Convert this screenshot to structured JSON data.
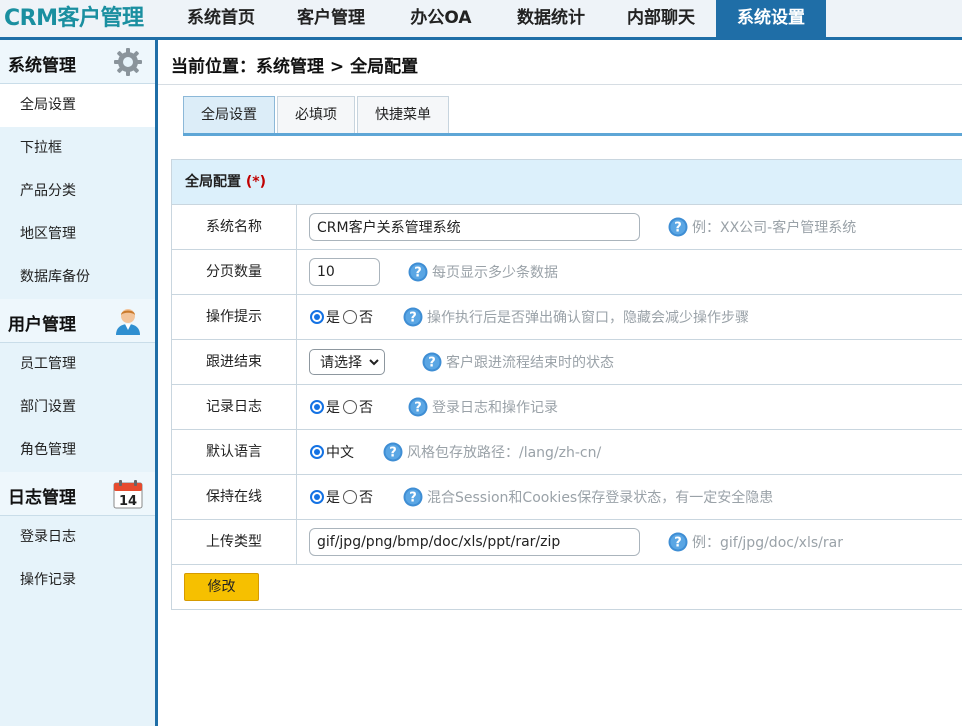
{
  "app": {
    "logo": "CRM客户管理"
  },
  "topnav": {
    "items": [
      {
        "label": "系统首页"
      },
      {
        "label": "客户管理"
      },
      {
        "label": "办公OA"
      },
      {
        "label": "数据统计"
      },
      {
        "label": "内部聊天"
      },
      {
        "label": "系统设置"
      }
    ],
    "active_index": 5
  },
  "sidebar": {
    "groups": [
      {
        "title": "系统管理",
        "icon": "gear-icon",
        "items": [
          {
            "label": "全局设置"
          },
          {
            "label": "下拉框"
          },
          {
            "label": "产品分类"
          },
          {
            "label": "地区管理"
          },
          {
            "label": "数据库备份"
          }
        ]
      },
      {
        "title": "用户管理",
        "icon": "user-icon",
        "items": [
          {
            "label": "员工管理"
          },
          {
            "label": "部门设置"
          },
          {
            "label": "角色管理"
          }
        ]
      },
      {
        "title": "日志管理",
        "icon": "calendar-icon",
        "icon_text": "14",
        "items": [
          {
            "label": "登录日志"
          },
          {
            "label": "操作记录"
          }
        ]
      }
    ],
    "active_item": "全局设置"
  },
  "breadcrumb": "当前位置：系统管理 > 全局配置",
  "tabs": [
    {
      "label": "全局设置"
    },
    {
      "label": "必填项"
    },
    {
      "label": "快捷菜单"
    }
  ],
  "panel": {
    "title": "全局配置",
    "required_mark": "(*)",
    "rows": {
      "system_name": {
        "label": "系统名称",
        "value": "CRM客户关系管理系统",
        "hint": "例：XX公司-客户管理系统"
      },
      "page_size": {
        "label": "分页数量",
        "value": "10",
        "hint": "每页显示多少条数据"
      },
      "op_prompt": {
        "label": "操作提示",
        "yes": "是",
        "no": "否",
        "selected": "是",
        "hint": "操作执行后是否弹出确认窗口，隐藏会减少操作步骤"
      },
      "follow_end": {
        "label": "跟进结束",
        "selected": "请选择",
        "hint": "客户跟进流程结束时的状态"
      },
      "log": {
        "label": "记录日志",
        "yes": "是",
        "no": "否",
        "selected": "是",
        "hint": "登录日志和操作记录"
      },
      "language": {
        "label": "默认语言",
        "option": "中文",
        "selected": "中文",
        "hint": "风格包存放路径：/lang/zh-cn/"
      },
      "keep_online": {
        "label": "保持在线",
        "yes": "是",
        "no": "否",
        "selected": "是",
        "hint": "混合Session和Cookies保存登录状态，有一定安全隐患"
      },
      "upload_types": {
        "label": "上传类型",
        "value": "gif/jpg/png/bmp/doc/xls/ppt/rar/zip",
        "hint": "例：gif/jpg/doc/xls/rar"
      }
    },
    "submit_label": "修改"
  },
  "colors": {
    "brand": "#1f6ea7",
    "logo": "#1a8fa0",
    "button": "#f6c000",
    "required": "#c00000"
  }
}
